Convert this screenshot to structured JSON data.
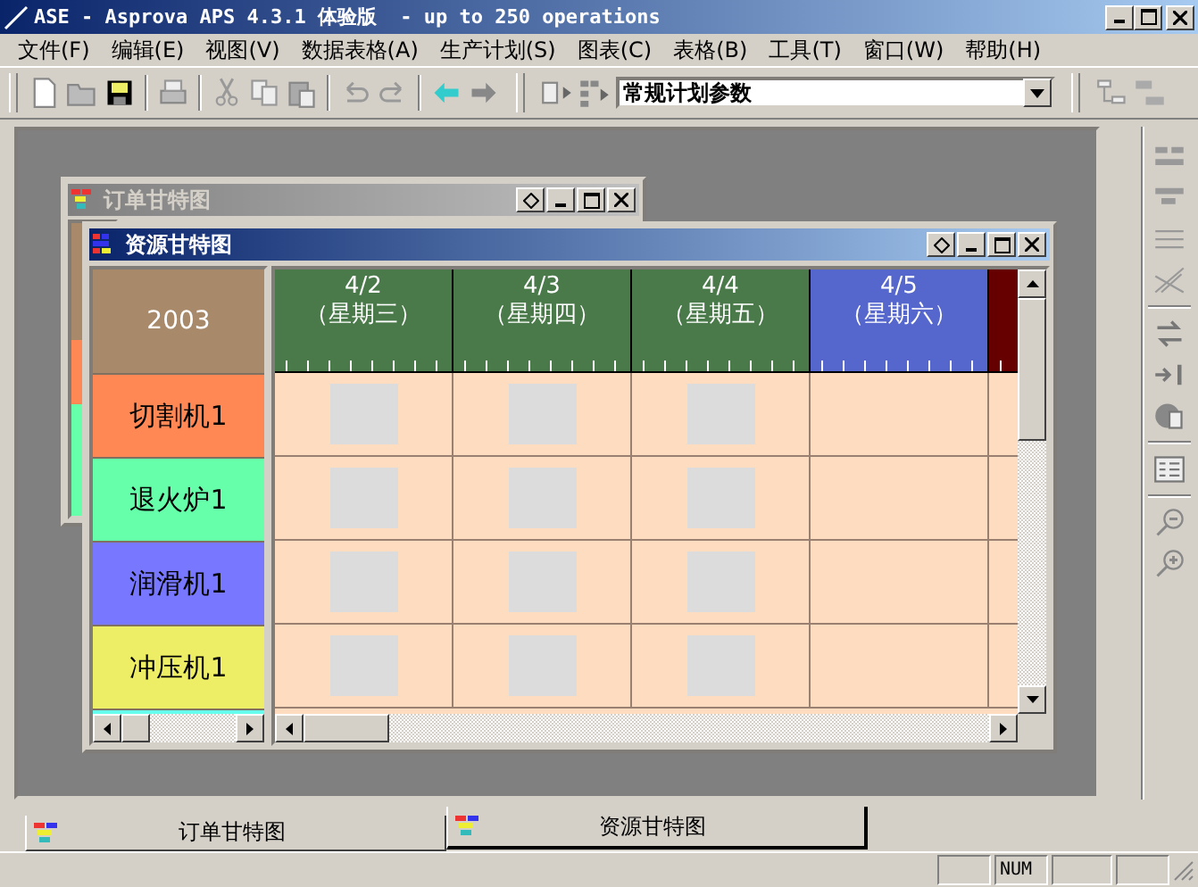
{
  "window": {
    "title": "ASE - Asprova APS 4.3.1 体验版  - up to 250 operations"
  },
  "menu": [
    "文件(F)",
    "编辑(E)",
    "视图(V)",
    "数据表格(A)",
    "生产计划(S)",
    "图表(C)",
    "表格(B)",
    "工具(T)",
    "窗口(W)",
    "帮助(H)"
  ],
  "toolbar": {
    "combo": {
      "value": "常规计划参数"
    }
  },
  "documents": [
    {
      "title": "订单甘特图",
      "active": false
    },
    {
      "title": "资源甘特图",
      "active": true,
      "year": "2003",
      "dates": [
        {
          "date": "4/2",
          "weekday": "（星期三）",
          "color": "#4a7a4a",
          "working": true
        },
        {
          "date": "4/3",
          "weekday": "（星期四）",
          "color": "#4a7a4a",
          "working": true
        },
        {
          "date": "4/4",
          "weekday": "（星期五）",
          "color": "#4a7a4a",
          "working": true
        },
        {
          "date": "4/5",
          "weekday": "（星期六）",
          "color": "#5566cc",
          "working": false
        },
        {
          "color": "#660000",
          "working": false
        }
      ],
      "resources": [
        {
          "name": "切割机1",
          "color": "#ff8855"
        },
        {
          "name": "退火炉1",
          "color": "#66ffaa"
        },
        {
          "name": "润滑机1",
          "color": "#7777ff"
        },
        {
          "name": "冲压机1",
          "color": "#eeee66"
        },
        {
          "color": "#66ffee"
        }
      ]
    }
  ],
  "tabs": [
    {
      "label": "订单甘特图",
      "selected": false
    },
    {
      "label": "资源甘特图",
      "selected": true
    }
  ],
  "status_bar": {
    "indicator": "NUM"
  }
}
